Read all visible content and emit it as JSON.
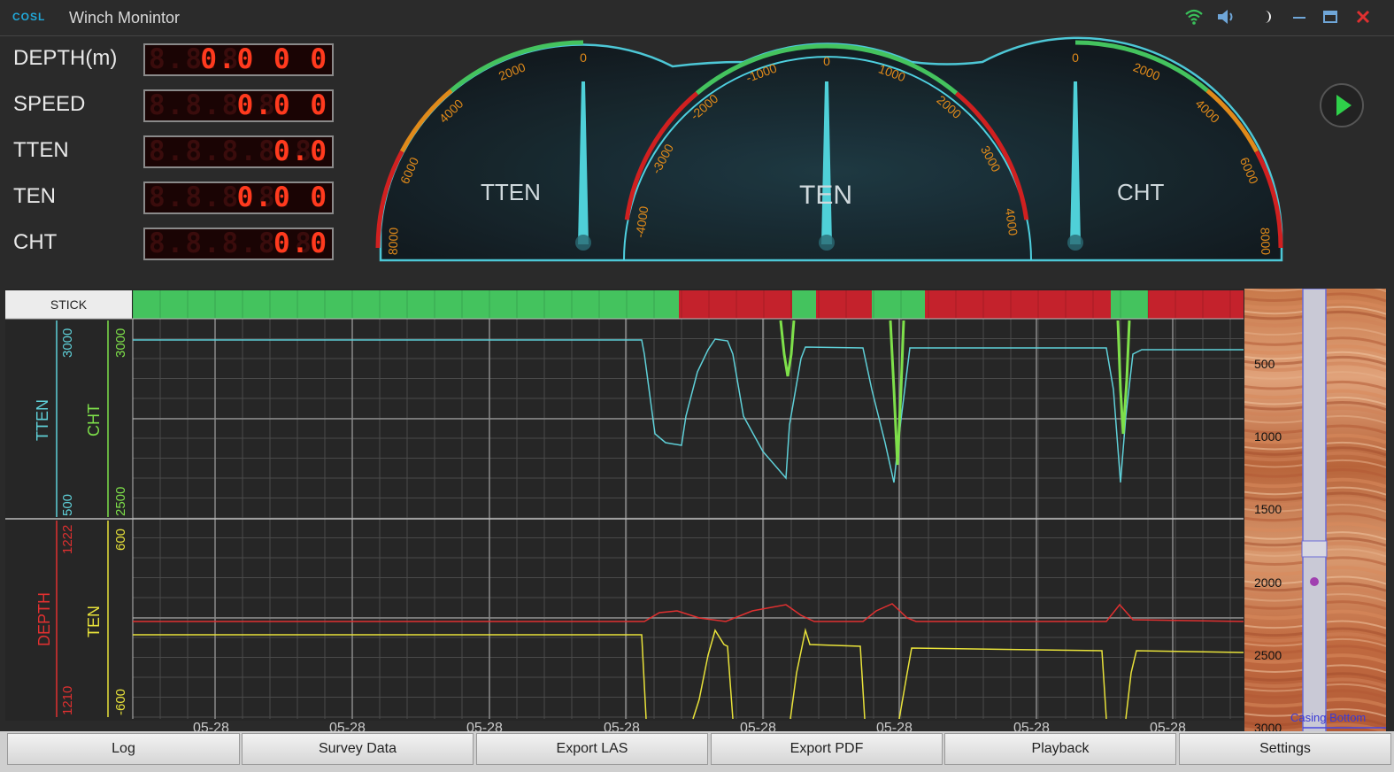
{
  "app": {
    "logo": "COSL",
    "title": "Winch Monintor"
  },
  "readouts": [
    {
      "label": "DEPTH(m)",
      "ghost": "8.8.8.",
      "value": "0.0 0 0"
    },
    {
      "label": "SPEED",
      "ghost": "8.8.8.8.",
      "value": "0.0 0"
    },
    {
      "label": "TTEN",
      "ghost": "8.8.8.8.8.",
      "value": "0.0"
    },
    {
      "label": "TEN",
      "ghost": "8.8.8.8.",
      "value": "0.0 0"
    },
    {
      "label": "CHT",
      "ghost": "8.8.8.8.8.",
      "value": "0.0"
    }
  ],
  "gauges": {
    "tten": {
      "label": "TTEN",
      "ticks": [
        "0",
        "2000",
        "4000",
        "6000",
        "8000"
      ]
    },
    "ten": {
      "label": "TEN",
      "ticks": [
        "-4000",
        "-3000",
        "-2000",
        "-1000",
        "0",
        "1000",
        "2000",
        "3000",
        "4000"
      ]
    },
    "cht": {
      "label": "CHT",
      "ticks": [
        "0",
        "2000",
        "4000",
        "6000",
        "8000"
      ]
    }
  },
  "colors": {
    "tten": "#5fd0d8",
    "cht": "#7ee04a",
    "depth": "#e03030",
    "ten": "#e8e23a",
    "stick_ok": "#44c35e",
    "stick_bad": "#c4222c"
  },
  "chart": {
    "stick_label": "STICK",
    "upper": {
      "tten": {
        "label": "TTEN",
        "max": "3000",
        "min": "500"
      },
      "cht": {
        "label": "CHT",
        "max": "3000",
        "min": "2500"
      }
    },
    "lower": {
      "depth": {
        "label": "DEPTH",
        "max": "1222",
        "min": "1210"
      },
      "ten": {
        "label": "TEN",
        "max": "600",
        "min": "-600"
      }
    },
    "x_ticks": [
      "05-28",
      "05-28",
      "05-28",
      "05-28",
      "05-28",
      "05-28",
      "05-28",
      "05-28"
    ]
  },
  "well": {
    "depth_labels": [
      "500",
      "1000",
      "1500",
      "2000",
      "2500",
      "3000"
    ],
    "casing_label": "Casing Bottom"
  },
  "buttons": [
    "Log",
    "Survey Data",
    "Export LAS",
    "Export PDF",
    "Playback",
    "Settings"
  ]
}
